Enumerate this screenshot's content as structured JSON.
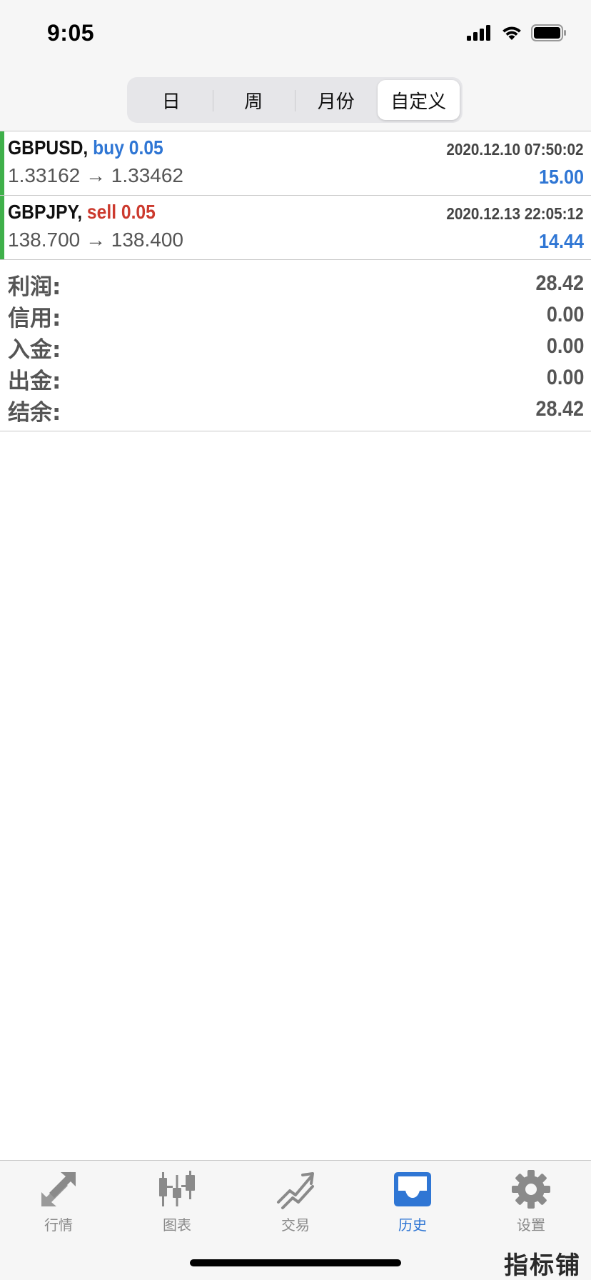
{
  "status_bar": {
    "time": "9:05",
    "icons": [
      "signal-icon",
      "wifi-icon",
      "battery-icon"
    ]
  },
  "period_tabs": [
    {
      "label": "日",
      "active": false
    },
    {
      "label": "周",
      "active": false
    },
    {
      "label": "月份",
      "active": false
    },
    {
      "label": "自定义",
      "active": true
    }
  ],
  "trades": [
    {
      "symbol": "GBPUSD,",
      "side": "buy 0.05",
      "datetime": "2020.12.10 07:50:02",
      "prices": "1.33162 → 1.33462",
      "profit": "15.00"
    },
    {
      "symbol": "GBPJPY,",
      "side": "sell 0.05",
      "datetime": "2020.12.13 22:05:12",
      "prices": "138.700 → 138.400",
      "profit": "14.44"
    }
  ],
  "summary": [
    {
      "label": "利润:",
      "value": "28.42"
    },
    {
      "label": "信用:",
      "value": "0.00"
    },
    {
      "label": "入金:",
      "value": "0.00"
    },
    {
      "label": "出金:",
      "value": "0.00"
    },
    {
      "label": "结余:",
      "value": "28.42"
    }
  ],
  "bottom_tabs": [
    {
      "label": "行情",
      "icon": "quotes-arrows-icon",
      "active": false
    },
    {
      "label": "图表",
      "icon": "candlestick-chart-icon",
      "active": false
    },
    {
      "label": "交易",
      "icon": "trade-chart-icon",
      "active": false
    },
    {
      "label": "历史",
      "icon": "history-inbox-icon",
      "active": true
    },
    {
      "label": "设置",
      "icon": "gear-icon",
      "active": false
    }
  ],
  "watermark": "指标铺",
  "colors": {
    "accent_blue": "#2f76d4",
    "sell_red": "#cc3a2e",
    "row_green": "#3fb04a",
    "inactive_gray": "#8a8a8a"
  }
}
